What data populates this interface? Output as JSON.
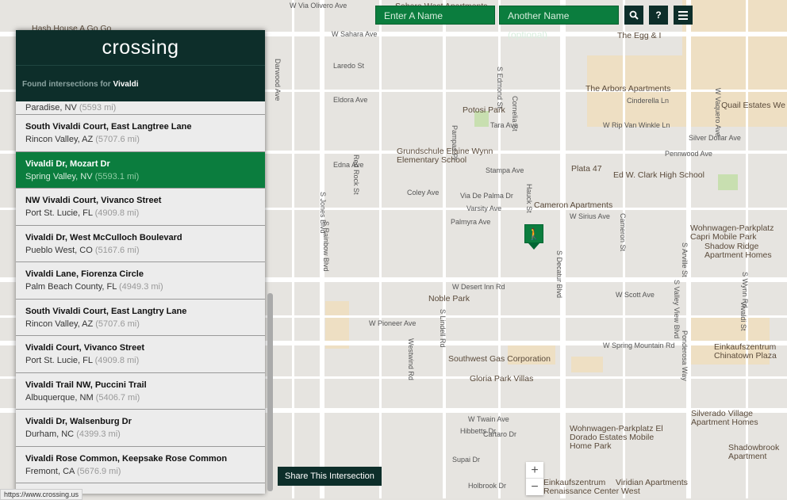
{
  "search": {
    "name1_placeholder": "Enter A Name",
    "name2_placeholder": "Another Name (optional)",
    "search_icon": "search-icon",
    "help_label": "?",
    "menu_icon": "menu-icon"
  },
  "panel": {
    "logo": "crossing",
    "found_prefix": "Found intersections for",
    "query": "Vivaldi",
    "partial_item": {
      "subtitle": "Paradise, NV",
      "distance": "(5593 mi)"
    },
    "items": [
      {
        "title": "South Vivaldi Court, East Langtree Lane",
        "place": "Rincon Valley, AZ",
        "distance": "(5707.6 mi)"
      },
      {
        "title": "Vivaldi Dr, Mozart Dr",
        "place": "Spring Valley, NV",
        "distance": "(5593.1 mi)",
        "selected": true
      },
      {
        "title": "NW Vivaldi Court, Vivanco Street",
        "place": "Port St. Lucie, FL",
        "distance": "(4909.8 mi)"
      },
      {
        "title": "Vivaldi Dr, West McCulloch Boulevard",
        "place": "Pueblo West, CO",
        "distance": "(5167.6 mi)"
      },
      {
        "title": "Vivaldi Lane, Fiorenza Circle",
        "place": "Palm Beach County, FL",
        "distance": "(4949.3 mi)"
      },
      {
        "title": "South Vivaldi Court, East Langtry Lane",
        "place": "Rincon Valley, AZ",
        "distance": "(5707.6 mi)"
      },
      {
        "title": "Vivaldi Court, Vivanco Street",
        "place": "Port St. Lucie, FL",
        "distance": "(4909.8 mi)"
      },
      {
        "title": "Vivaldi Trail NW, Puccini Trail",
        "place": "Albuquerque, NM",
        "distance": "(5406.7 mi)"
      },
      {
        "title": "Vivaldi Dr, Walsenburg Dr",
        "place": "Durham, NC",
        "distance": "(4399.3 mi)"
      },
      {
        "title": "Vivaldi Rose Common, Keepsake Rose Common",
        "place": "Fremont, CA",
        "distance": "(5676.9 mi)"
      }
    ]
  },
  "share_label": "Share This Intersection",
  "zoom": {
    "in": "+",
    "out": "−"
  },
  "status_url": "https://www.crossing.us",
  "colors": {
    "brand_green": "#0b7d3e",
    "dark": "#0d2e2a"
  },
  "map": {
    "labels": [
      "W Via Olivero Ave",
      "Sahara West Apartments",
      "Hash House A Go Go",
      "W Sahara Ave",
      "The Egg & I",
      "Laredo St",
      "Eldora Ave",
      "Potosi Park",
      "Tara Ave",
      "The Arbors Apartments",
      "Cinderella Ln",
      "Quail Estates We",
      "W Rip Van Winkle Ln",
      "Silver Dollar Ave",
      "Pennwood Ave",
      "Grundschule Elaine Wynn Elementary School",
      "Edna Ave",
      "Stampa Ave",
      "Plata 47",
      "Ed W. Clark High School",
      "Coley Ave",
      "Via De Palma Dr",
      "Varsity Ave",
      "Cameron Apartments",
      "W Sirius Ave",
      "Palmyra Ave",
      "Wohnwagen-Parkplatz Capri Mobile Park",
      "Shadow Ridge Apartment Homes",
      "W Desert Inn Rd",
      "Noble Park",
      "W Scott Ave",
      "W Pioneer Ave",
      "W Spring Mountain Rd",
      "Einkaufszentrum Chinatown Plaza",
      "Southwest Gas Corporation",
      "Gloria Park Villas",
      "W Twain Ave",
      "Hibbetts Dr",
      "Cartaro Dr",
      "Supai Dr",
      "Wohnwagen-Parkplatz El Dorado Estates Mobile Home Park",
      "Silverado Village Apartment Homes",
      "Shadowbrook Apartment",
      "Viridian Apartments",
      "Einkaufszentrum Renaissance Center West",
      "Holbrook Dr",
      "S Jones Blvd",
      "S Rainbow Blvd",
      "S Decatur Blvd",
      "S Valley View Blvd",
      "S Lindell Rd",
      "Westwind Rd",
      "S Edmond St",
      "Cornelia St",
      "Pampas Pl",
      "Red Rock St",
      "Hauck St",
      "Cameron St",
      "S Arville St",
      "S Wynn Rd",
      "Vivaldi St",
      "Ponderosa Way",
      "Darwood Ave",
      "W Vaquero Ave"
    ]
  }
}
